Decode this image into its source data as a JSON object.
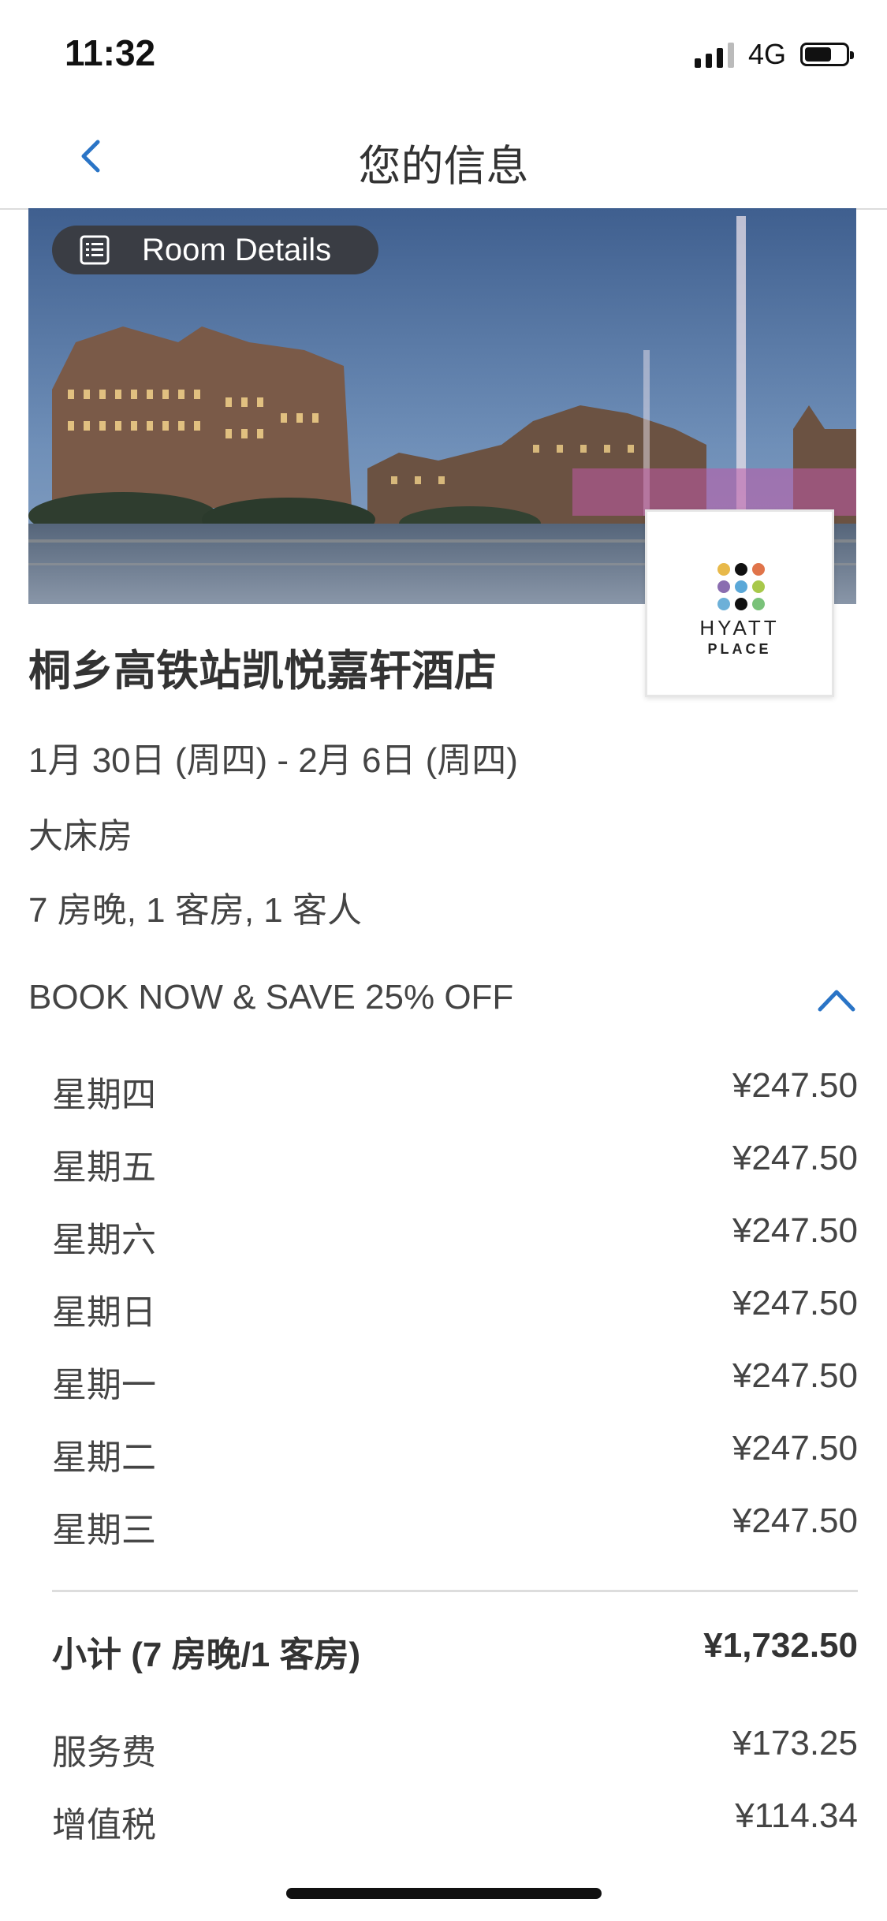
{
  "status_bar": {
    "time": "11:32",
    "network": "4G",
    "battery_level": 0.65
  },
  "nav": {
    "title": "您的信息",
    "back_icon": "chevron-left-icon"
  },
  "hero": {
    "room_details_label": "Room Details",
    "room_details_icon": "list-icon"
  },
  "logo": {
    "line1": "HYATT",
    "line2": "PLACE"
  },
  "hotel": {
    "name": "桐乡高铁站凯悦嘉轩酒店",
    "dates": "1月 30日 (周四) - 2月 6日 (周四)",
    "room_type": "大床房",
    "stay_summary": "7 房晚, 1 客房, 1 客人"
  },
  "offer": {
    "title": "BOOK NOW & SAVE 25% OFF",
    "toggle_icon": "chevron-up-icon",
    "accent_color": "#2a74c6",
    "nightly_rates": [
      {
        "day": "星期四",
        "price": "¥247.50"
      },
      {
        "day": "星期五",
        "price": "¥247.50"
      },
      {
        "day": "星期六",
        "price": "¥247.50"
      },
      {
        "day": "星期日",
        "price": "¥247.50"
      },
      {
        "day": "星期一",
        "price": "¥247.50"
      },
      {
        "day": "星期二",
        "price": "¥247.50"
      },
      {
        "day": "星期三",
        "price": "¥247.50"
      }
    ]
  },
  "totals": {
    "subtotal_label": "小计 (7 房晚/1 客房)",
    "subtotal_value": "¥1,732.50",
    "service_fee_label": "服务费",
    "service_fee_value": "¥173.25",
    "vat_label": "增值税",
    "vat_value": "¥114.34"
  }
}
